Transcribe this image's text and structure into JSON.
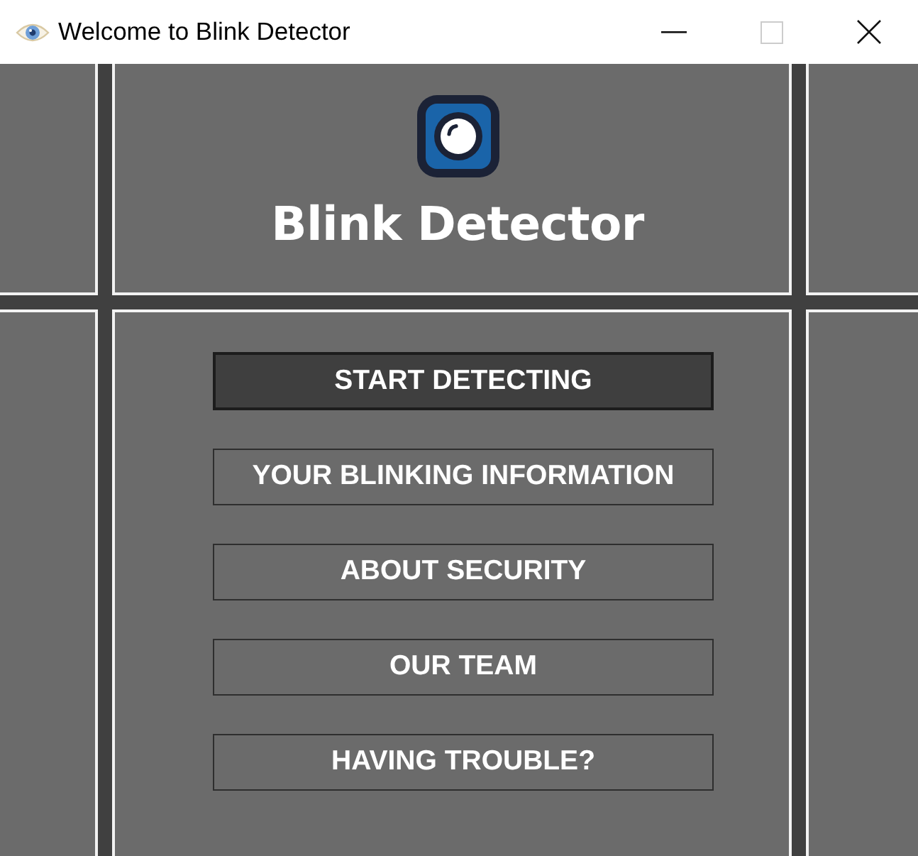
{
  "window": {
    "title": "Welcome to Blink Detector",
    "controls": [
      {
        "kind": "minimize",
        "disabled": false
      },
      {
        "kind": "maximize",
        "disabled": true
      },
      {
        "kind": "close",
        "disabled": false
      }
    ]
  },
  "header": {
    "app_name": "Blink Detector"
  },
  "menu": [
    {
      "label": "START DETECTING",
      "selected": true
    },
    {
      "label": "YOUR BLINKING INFORMATION",
      "selected": false
    },
    {
      "label": "ABOUT SECURITY",
      "selected": false
    },
    {
      "label": "OUR TEAM",
      "selected": false
    },
    {
      "label": "HAVING TROUBLE?",
      "selected": false
    }
  ]
}
